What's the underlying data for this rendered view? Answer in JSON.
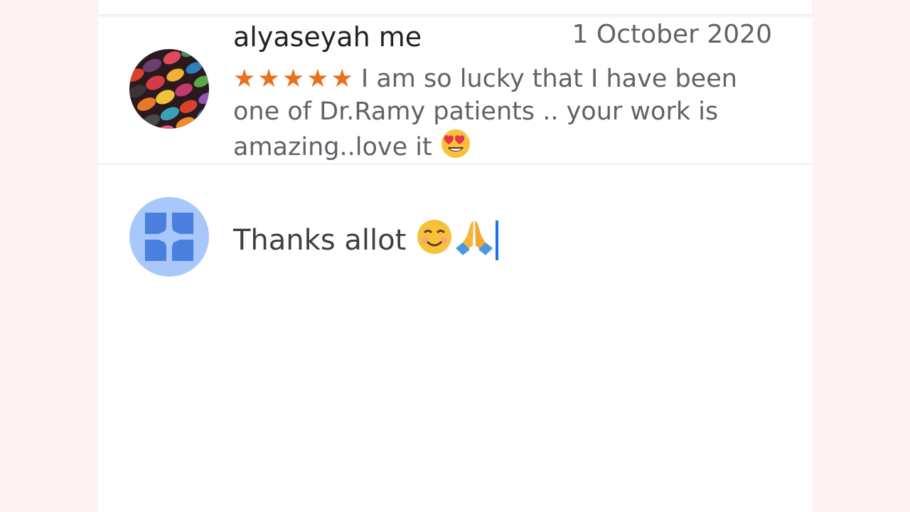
{
  "review": {
    "author": "alyaseyah me",
    "date": "1 October 2020",
    "stars": "★★★★★",
    "rating": 5,
    "text": "I am so lucky that I have been one of Dr.Ramy patients .. your work is amazing..love it",
    "emoji": "heart-eyes-emoji"
  },
  "reply": {
    "text": "Thanks allot",
    "emojis": [
      "smiling-face-emoji",
      "folded-hands-emoji"
    ]
  },
  "colors": {
    "star": "#e8711c",
    "business_avatar_bg": "#a8c7fa",
    "business_icon": "#4a7fe0",
    "caret": "#1a73e8"
  }
}
